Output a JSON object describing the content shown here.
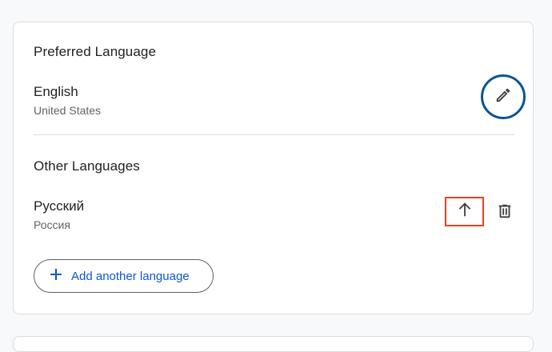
{
  "preferred": {
    "title": "Preferred Language",
    "language": "English",
    "region": "United States"
  },
  "other": {
    "title": "Other Languages",
    "languages": [
      {
        "language": "Русский",
        "region": "Россия"
      }
    ]
  },
  "actions": {
    "add_label": "Add another language"
  },
  "colors": {
    "focus_ring": "#0b5394",
    "highlight_box": "#e8421a",
    "link_blue": "#0b57d0",
    "icon_gray": "#3c4043"
  },
  "icons": {
    "edit": "pencil-icon",
    "move_up": "arrow-up-icon",
    "delete": "trash-icon",
    "add": "plus-icon"
  }
}
